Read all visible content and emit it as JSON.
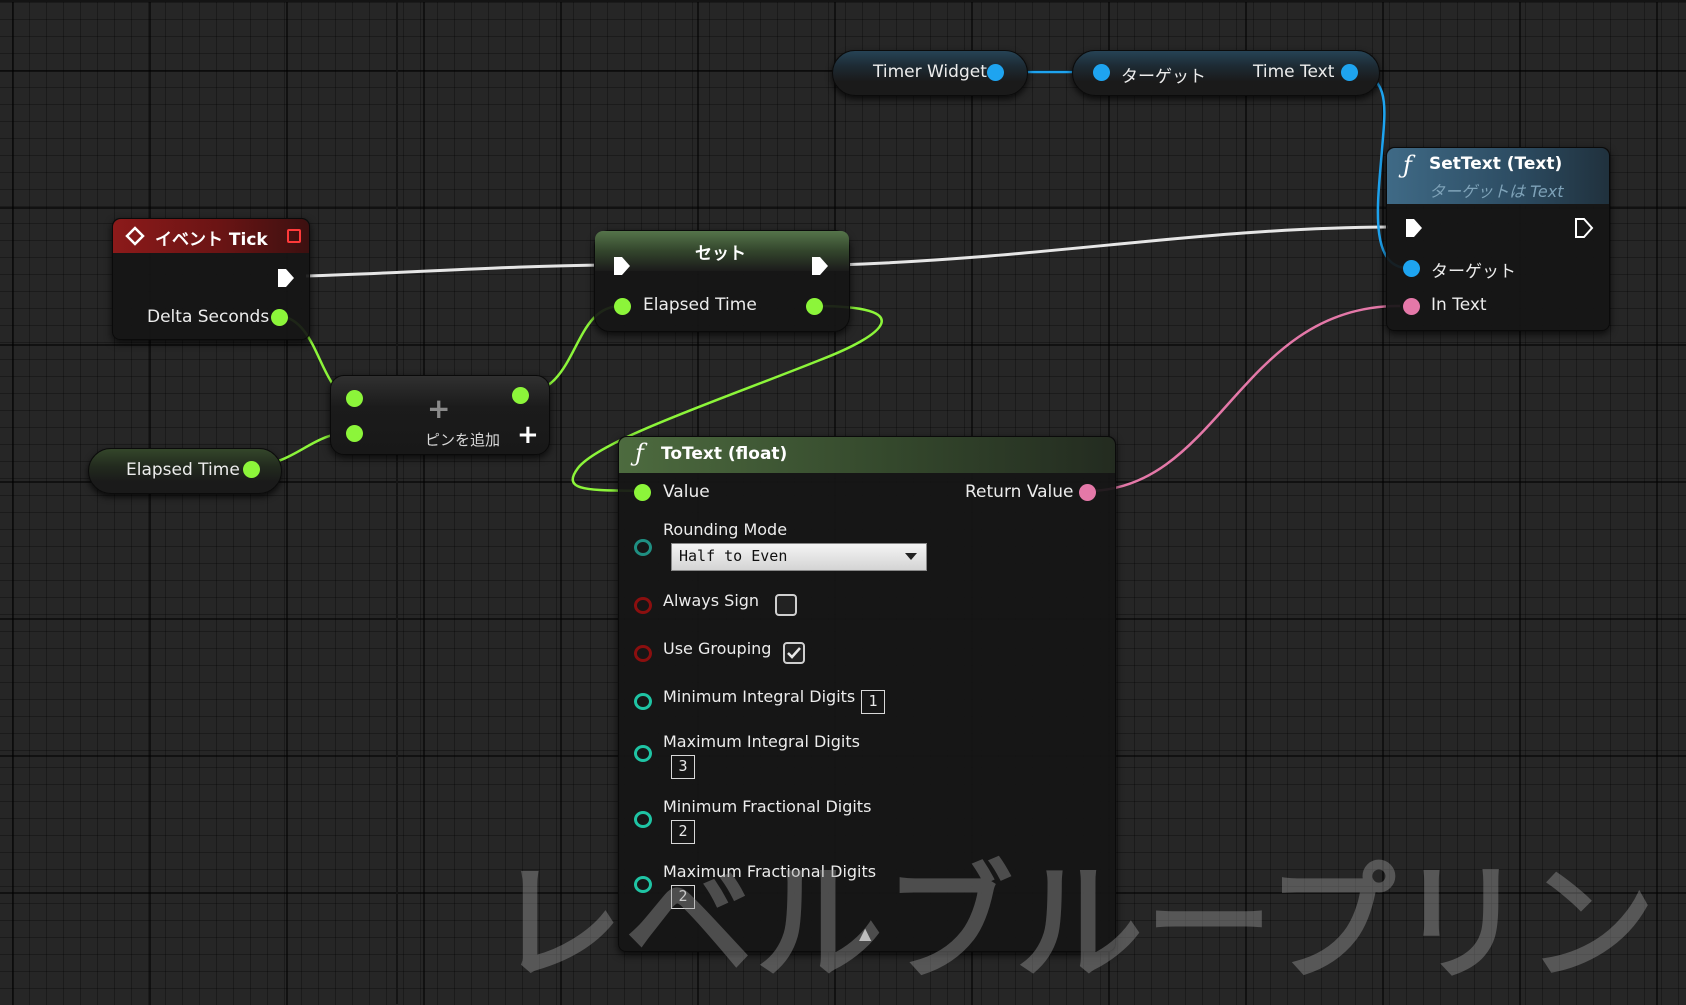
{
  "colors": {
    "exec": "#ffffff",
    "float": "#8cf53a",
    "object": "#1ea4f0",
    "text": "#e478a8",
    "byte": "#1f8f82",
    "bool": "#8b0f0f",
    "int": "#1fc4a4",
    "event_header": "#8c1a1a",
    "function_header": "#3f6a86",
    "pure_header": "#4d6b3f"
  },
  "event_tick": {
    "title": "イベント Tick",
    "icon": "event-diamond-icon",
    "output_pin": "Delta Seconds"
  },
  "elapsed_time_get": {
    "label": "Elapsed Time"
  },
  "add_node": {
    "add_pin_label": "ピンを追加",
    "plus_icon": "+"
  },
  "set_node": {
    "title": "セット",
    "input_pin": "Elapsed Time"
  },
  "timer_widget_get": {
    "label": "Timer Widget"
  },
  "time_text_get": {
    "target_label": "ターゲット",
    "output_label": "Time Text"
  },
  "set_text_node": {
    "title": "SetText (Text)",
    "subtitle": "ターゲットは Text",
    "target_pin": "ターゲット",
    "in_text_pin": "In Text"
  },
  "to_text_node": {
    "title": "ToText (float)",
    "value_pin": "Value",
    "return_pin": "Return Value",
    "rounding_mode_label": "Rounding Mode",
    "rounding_mode_value": "Half to Even",
    "always_sign_label": "Always Sign",
    "always_sign_checked": false,
    "use_grouping_label": "Use Grouping",
    "use_grouping_checked": true,
    "min_integral_label": "Minimum Integral Digits",
    "min_integral_value": "1",
    "max_integral_label": "Maximum Integral Digits",
    "max_integral_value": "3",
    "min_fractional_label": "Minimum Fractional Digits",
    "min_fractional_value": "2",
    "max_fractional_label": "Maximum Fractional Digits",
    "max_fractional_value": "2",
    "collapse_icon": "▲"
  },
  "watermark": "レベルブループリント"
}
